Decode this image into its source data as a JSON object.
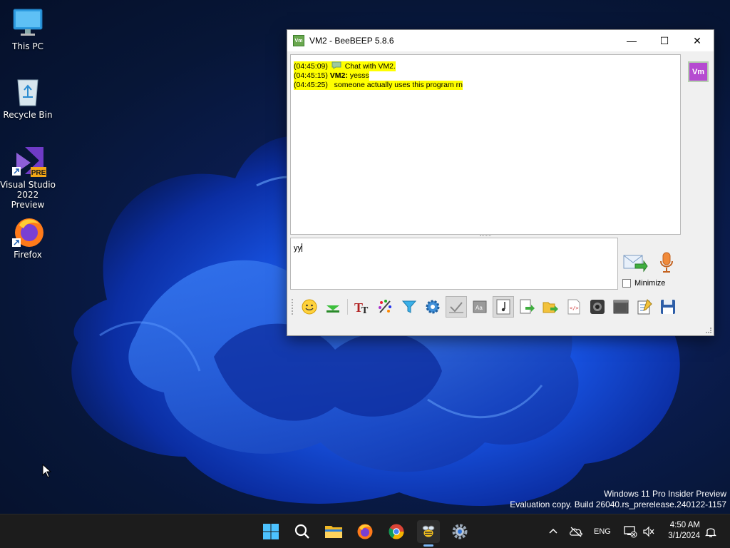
{
  "desktop": {
    "icons": [
      {
        "label_line1": "This PC",
        "label_line2": ""
      },
      {
        "label_line1": "Recycle Bin",
        "label_line2": ""
      },
      {
        "label_line1": "Visual Studio",
        "label_line2": "2022 Preview",
        "badge": "PRE"
      },
      {
        "label_line1": "Firefox",
        "label_line2": ""
      }
    ],
    "watermark": {
      "line1": "Windows 11 Pro Insider Preview",
      "line2": "Evaluation copy. Build 26040.rs_prerelease.240122-1157"
    }
  },
  "window": {
    "title": "VM2 - BeeBEEP 5.8.6",
    "app_icon_text": "Vm",
    "controls": {
      "minimize": "—",
      "maximize": "☐",
      "close": "✕"
    },
    "chat": [
      {
        "time": "(04:45:09)",
        "sender": "",
        "text": "Chat with VM2."
      },
      {
        "time": "(04:45:15)",
        "sender": "VM2:",
        "text": "yesss"
      },
      {
        "time": "(04:45:25)",
        "sender": "",
        "text": "someone actually uses this program rn"
      }
    ],
    "input_value": "yy",
    "user_badge": "Vm",
    "minimize_label": "Minimize",
    "minimize_checked": false,
    "toolbar_icons": [
      "emoticon-icon",
      "highlight-icon",
      "font-icon",
      "color-palette-icon",
      "filter-icon",
      "settings-gear-icon",
      "spellcheck-icon",
      "dictionary-icon",
      "music-note-icon",
      "send-file-icon",
      "send-folder-icon",
      "code-icon",
      "screenshot-icon",
      "screen-capture-icon",
      "edit-note-icon",
      "save-chat-icon"
    ]
  },
  "taskbar": {
    "apps": [
      "start-icon",
      "search-icon",
      "file-explorer-icon",
      "firefox-icon",
      "chrome-icon",
      "beebeep-icon",
      "settings-icon"
    ],
    "language": "ENG",
    "time": "4:50 AM",
    "date": "3/1/2024"
  },
  "colors": {
    "chat_highlight": "#ffff00",
    "badge": "#b54bd0",
    "taskbar": "#1c1c1c",
    "accent": "#7db7f5"
  }
}
